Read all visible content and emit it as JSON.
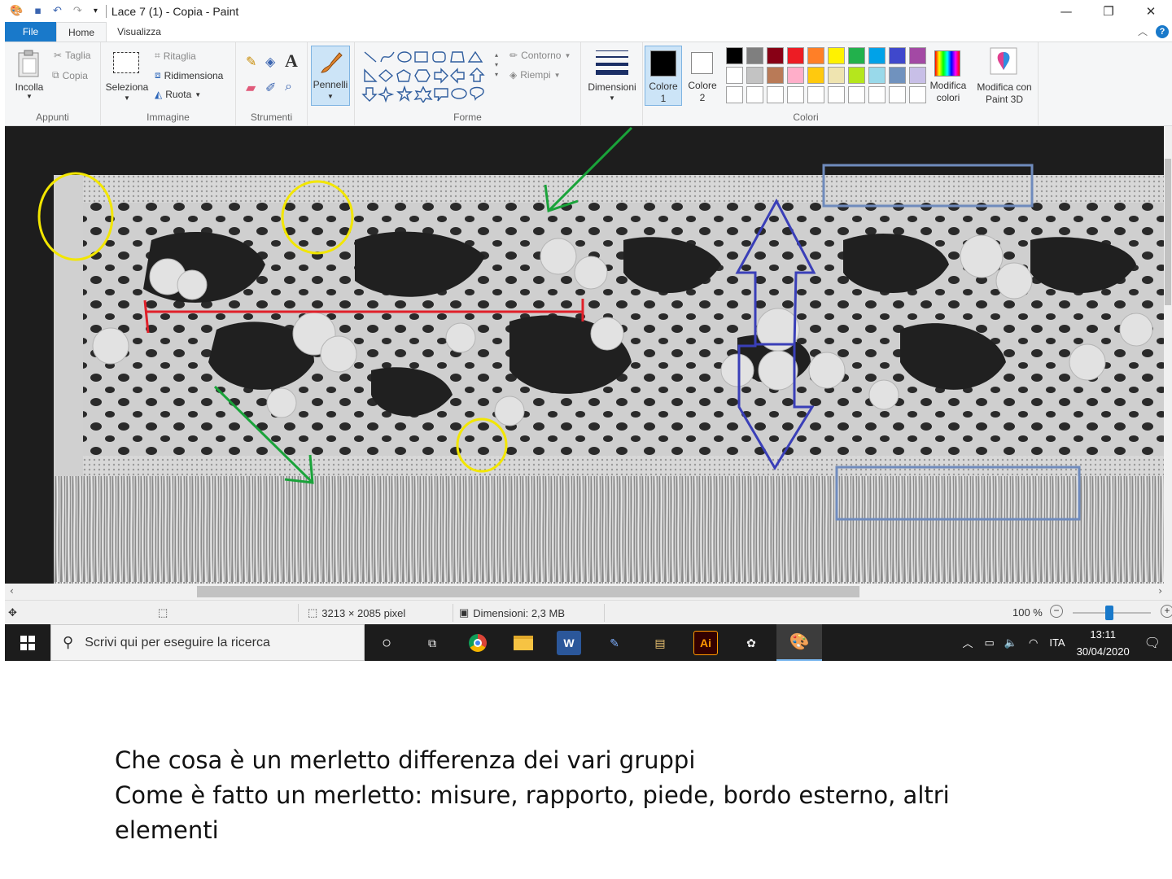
{
  "window": {
    "title": "Lace 7 (1) - Copia - Paint",
    "minimize": "—",
    "maximize": "❐",
    "close": "✕"
  },
  "tabs": [
    {
      "label": "File"
    },
    {
      "label": "Home"
    },
    {
      "label": "Visualizza"
    }
  ],
  "ribbon": {
    "appunti": {
      "paste": "Incolla",
      "cut": "Taglia",
      "copy": "Copia",
      "group": "Appunti"
    },
    "immagine": {
      "select": "Seleziona",
      "crop": "Ritaglia",
      "resize": "Ridimensiona",
      "rotate": "Ruota",
      "group": "Immagine"
    },
    "strumenti": {
      "group": "Strumenti",
      "text_tool": "A"
    },
    "pennelli": {
      "label": "Pennelli"
    },
    "forme": {
      "outline": "Contorno",
      "fill": "Riempi",
      "group": "Forme"
    },
    "dimensioni": {
      "label": "Dimensioni"
    },
    "colori": {
      "color1": "Colore",
      "color1_num": "1",
      "color2": "Colore",
      "color2_num": "2",
      "edit1": "Modifica",
      "edit2": "colori",
      "paint3d1": "Modifica con",
      "paint3d2": "Paint 3D",
      "group": "Colori",
      "palette_row1": [
        "#000000",
        "#7f7f7f",
        "#880015",
        "#ed1c24",
        "#ff7f27",
        "#fff200",
        "#22b14c",
        "#00a2e8",
        "#3f48cc",
        "#a349a4"
      ],
      "palette_row2": [
        "#ffffff",
        "#c3c3c3",
        "#b97a57",
        "#ffaec9",
        "#ffc90e",
        "#efe4b0",
        "#b5e61d",
        "#99d9ea",
        "#7092be",
        "#c8bfe7"
      ],
      "selected1": "#000000",
      "selected2": "#ffffff"
    }
  },
  "status": {
    "size": "3213 × 2085 pixel",
    "filesize": "Dimensioni: 2,3 MB",
    "zoom": "100 %",
    "zoom_fraction": 0.47
  },
  "taskbar": {
    "search_placeholder": "Scrivi qui per eseguire la ricerca",
    "lang": "ITA",
    "time": "13:11",
    "date": "30/04/2020",
    "illustrator_label": "Ai"
  },
  "caption": {
    "line1": "Che cosa è un merletto differenza dei vari gruppi",
    "line2": "Come è fatto un merletto: misure, rapporto, piede, bordo esterno, altri elementi"
  },
  "colors": {
    "accent": "#1979ca",
    "annotation_yellow": "#f2e600",
    "annotation_green": "#1aa33a",
    "annotation_red": "#e0202a",
    "annotation_blue": "#3a3fb8",
    "annotation_steel": "#6f8bbd"
  }
}
